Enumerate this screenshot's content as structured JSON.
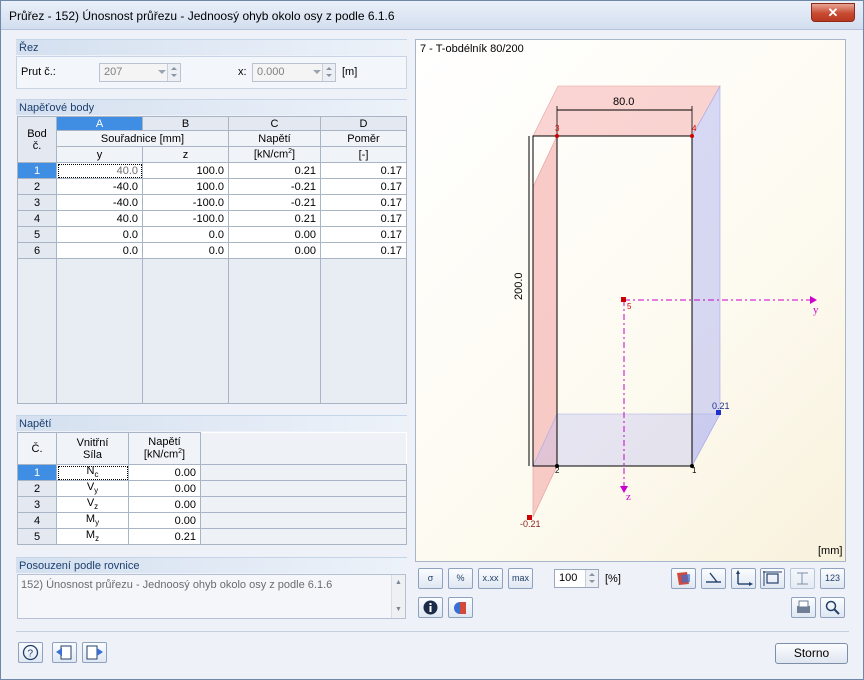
{
  "window": {
    "title": "Průřez - 152) Únosnost průřezu - Jednoosý ohyb okolo osy z podle 6.1.6",
    "close_label": "✕"
  },
  "rez": {
    "header": "Řez",
    "member_label": "Prut č.:",
    "member_value": "207",
    "x_label": "x:",
    "x_value": "0.000",
    "x_unit": "[m]"
  },
  "stress_points": {
    "header": "Napěťové body",
    "col_letters": [
      "A",
      "B",
      "C",
      "D"
    ],
    "bod_label": "Bod",
    "c_label": "č.",
    "coords_header": "Souřadnice [mm]",
    "y_label": "y",
    "z_label": "z",
    "stress_header": "Napětí",
    "stress_unit": "[kN/cm2]",
    "ratio_header": "Poměr",
    "ratio_unit": "[-]",
    "rows": [
      {
        "no": "1",
        "y": "40.0",
        "z": "100.0",
        "stress": "0.21",
        "ratio": "0.17"
      },
      {
        "no": "2",
        "y": "-40.0",
        "z": "100.0",
        "stress": "-0.21",
        "ratio": "0.17"
      },
      {
        "no": "3",
        "y": "-40.0",
        "z": "-100.0",
        "stress": "-0.21",
        "ratio": "0.17"
      },
      {
        "no": "4",
        "y": "40.0",
        "z": "-100.0",
        "stress": "0.21",
        "ratio": "0.17"
      },
      {
        "no": "5",
        "y": "0.0",
        "z": "0.0",
        "stress": "0.00",
        "ratio": "0.17"
      },
      {
        "no": "6",
        "y": "0.0",
        "z": "0.0",
        "stress": "0.00",
        "ratio": "0.17"
      }
    ]
  },
  "forces": {
    "header": "Napětí",
    "c_label": "Č.",
    "force_header_1": "Vnitřní",
    "force_header_2": "Síla",
    "stress_header": "Napětí",
    "stress_unit": "[kN/cm2]",
    "rows": [
      {
        "no": "1",
        "force": "N",
        "sub": "c",
        "value": "0.00"
      },
      {
        "no": "2",
        "force": "V",
        "sub": "y",
        "value": "0.00"
      },
      {
        "no": "3",
        "force": "V",
        "sub": "z",
        "value": "0.00"
      },
      {
        "no": "4",
        "force": "M",
        "sub": "y",
        "value": "0.00"
      },
      {
        "no": "5",
        "force": "M",
        "sub": "z",
        "value": "0.21"
      }
    ]
  },
  "check": {
    "header": "Posouzení podle rovnice",
    "text": "152) Únosnost průřezu - Jednoosý ohyb okolo osy z podle 6.1.6"
  },
  "graphic": {
    "title": "7 - T-obdélník 80/200",
    "width_label": "80.0",
    "height_label": "200.0",
    "axis_y": "y",
    "axis_z": "z",
    "unit": "[mm]",
    "pt1": "1",
    "pt2": "2",
    "pt3": "3",
    "pt4": "4",
    "pt5": "5",
    "max_value": "0.21",
    "min_value": "-0.21",
    "colors": {
      "positive": "#b7b9f0",
      "negative": "#f3a2a2",
      "axis": "#cc00cc"
    }
  },
  "toolbar": {
    "btn1": "σ",
    "btn2": "%",
    "btn3": "x.xx",
    "btn4": "max",
    "zoom_value": "100",
    "zoom_unit": "[%]",
    "btn_123": "123"
  },
  "footer": {
    "cancel_label": "Storno"
  }
}
